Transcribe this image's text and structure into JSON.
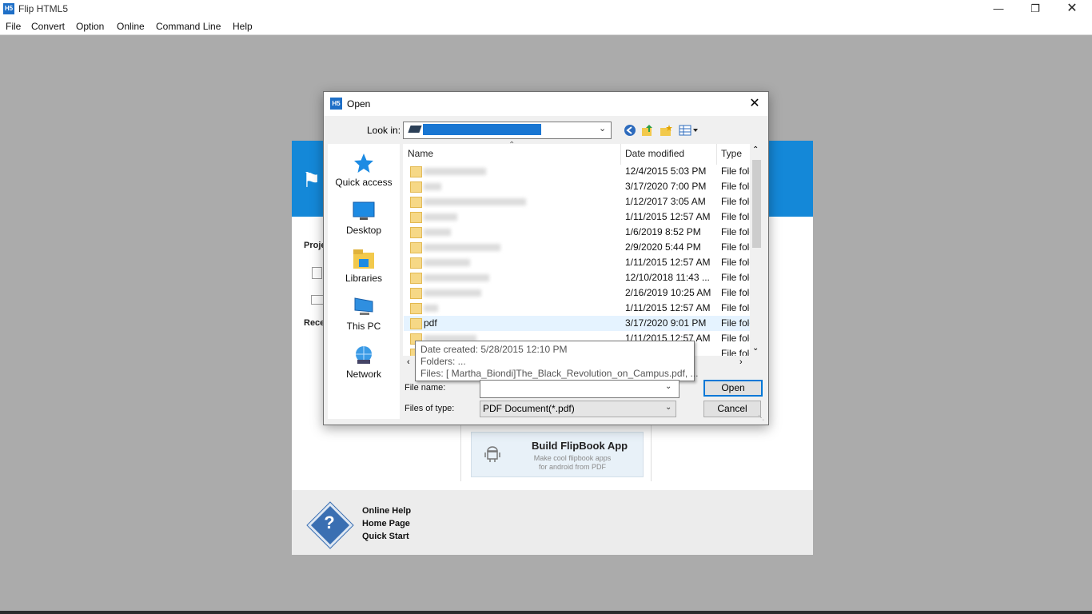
{
  "app": {
    "logo_text": "H5",
    "title": "Flip HTML5",
    "menu": [
      "File",
      "Convert",
      "Option",
      "Online",
      "Command Line",
      "Help"
    ]
  },
  "background": {
    "side_project": "Proje",
    "side_recent": "Rece",
    "card_title": "Build FlipBook App",
    "card_sub_1": "Make cool flipbook apps",
    "card_sub_2": "for android from PDF",
    "footer_links": [
      "Online Help",
      "Home Page",
      "Quick Start"
    ]
  },
  "dialog": {
    "logo_text": "H5",
    "title": "Open",
    "look_in_label": "Look in:",
    "places": [
      {
        "label": "Quick access",
        "icon": "star-icon"
      },
      {
        "label": "Desktop",
        "icon": "desktop-icon"
      },
      {
        "label": "Libraries",
        "icon": "libraries-icon"
      },
      {
        "label": "This PC",
        "icon": "computer-icon"
      },
      {
        "label": "Network",
        "icon": "network-icon"
      }
    ],
    "columns": {
      "name": "Name",
      "date": "Date modified",
      "type": "Type"
    },
    "rows": [
      {
        "name": "",
        "date": "12/4/2015 5:03 PM",
        "type": "File folder"
      },
      {
        "name": "",
        "date": "3/17/2020 7:00 PM",
        "type": "File folder"
      },
      {
        "name": "",
        "date": "1/12/2017 3:05 AM",
        "type": "File folder"
      },
      {
        "name": "",
        "date": "1/11/2015 12:57 AM",
        "type": "File folder"
      },
      {
        "name": "",
        "date": "1/6/2019 8:52 PM",
        "type": "File folder"
      },
      {
        "name": "",
        "date": "2/9/2020 5:44 PM",
        "type": "File folder"
      },
      {
        "name": "",
        "date": "1/11/2015 12:57 AM",
        "type": "File folder"
      },
      {
        "name": "",
        "date": "12/10/2018 11:43 ...",
        "type": "File folder"
      },
      {
        "name": "",
        "date": "2/16/2019 10:25 AM",
        "type": "File folder"
      },
      {
        "name": "",
        "date": "1/11/2015 12:57 AM",
        "type": "File folder"
      },
      {
        "name": "pdf",
        "date": "3/17/2020 9:01 PM",
        "type": "File folder",
        "selected": true
      },
      {
        "name": "",
        "date": "1/11/2015 12:57 AM",
        "type": "File folder"
      },
      {
        "name": "",
        "date": "",
        "type": "File folder"
      }
    ],
    "tooltip": {
      "line1": "Date created: 5/28/2015 12:10 PM",
      "line2": "Folders: ...",
      "line3": "Files: [ Martha_Biondi]The_Black_Revolution_on_Campus.pdf, ..."
    },
    "file_name_label": "File name:",
    "file_name_value": "",
    "files_of_type_label": "Files of type:",
    "files_of_type_value": "PDF Document(*.pdf)",
    "open_label": "Open",
    "cancel_label": "Cancel"
  }
}
